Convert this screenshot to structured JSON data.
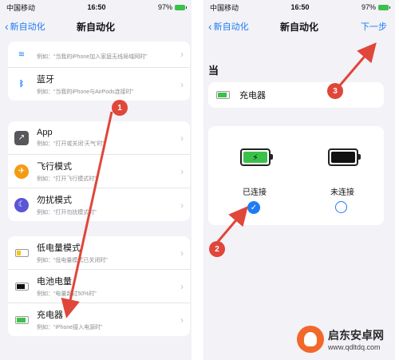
{
  "status": {
    "carrier": "中国移动",
    "time": "16:50",
    "battery": "97%"
  },
  "left": {
    "back_label": "新自动化",
    "title": "新自动化",
    "card1": [
      {
        "icon": "wifi-icon",
        "label": "",
        "hint": "例如：“当我的iPhone加入家庭无线局域网时”"
      },
      {
        "icon": "bluetooth-icon",
        "label": "蓝牙",
        "hint": "例如：“当我的iPhone与AirPods连接时”"
      }
    ],
    "card2": [
      {
        "icon": "app-icon",
        "label": "App",
        "hint": "例如：“打开或关闭‘天气’时”"
      },
      {
        "icon": "airplane-icon",
        "label": "飞行模式",
        "hint": "例如：“打开飞行模式时”"
      },
      {
        "icon": "moon-icon",
        "label": "勿扰模式",
        "hint": "例如：“打开勿扰模式时”"
      }
    ],
    "card3": [
      {
        "icon": "low-battery-icon",
        "label": "低电量模式",
        "hint": "例如：“低电量模式已关闭时”"
      },
      {
        "icon": "battery-level-icon",
        "label": "电池电量",
        "hint": "例如：“电量超过50%时”"
      },
      {
        "icon": "charger-icon",
        "label": "充电器",
        "hint": "例如：“iPhone接入电源时”"
      }
    ]
  },
  "right": {
    "back_label": "新自动化",
    "title": "新自动化",
    "next_label": "下一步",
    "section": "当",
    "selected_label": "充电器",
    "connected_label": "已连接",
    "disconnected_label": "未连接"
  },
  "markers": [
    "1",
    "2",
    "3"
  ],
  "watermark": {
    "name": "启东安卓网",
    "url": "www.qdltdq.com"
  },
  "colors": {
    "accent": "#1e7cf2",
    "marker": "#e0463a",
    "charge": "#3bc14a"
  }
}
